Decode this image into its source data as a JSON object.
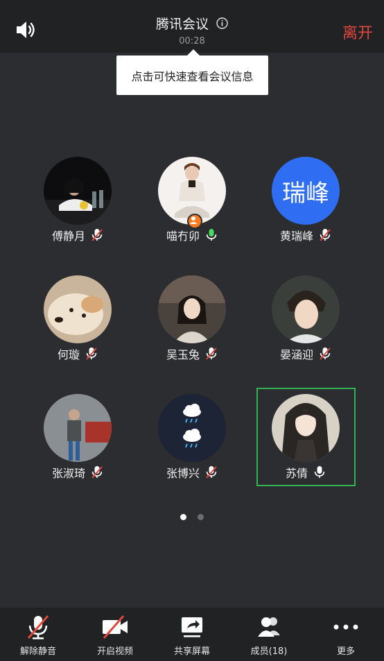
{
  "header": {
    "title": "腾讯会议",
    "timer": "00:28",
    "leave_label": "离开"
  },
  "tooltip": {
    "text": "点击可快速查看会议信息"
  },
  "participants": [
    {
      "name": "傅静月",
      "mic": "muted"
    },
    {
      "name": "喵冇卯",
      "mic": "on",
      "host": true
    },
    {
      "name": "黄瑞峰",
      "mic": "muted",
      "avatar_text": "瑞峰"
    },
    {
      "name": "何璇",
      "mic": "muted"
    },
    {
      "name": "吴玉兔",
      "mic": "muted"
    },
    {
      "name": "晏涵迎",
      "mic": "muted"
    },
    {
      "name": "张淑琦",
      "mic": "muted"
    },
    {
      "name": "张博兴",
      "mic": "muted"
    },
    {
      "name": "苏倩",
      "mic": "on",
      "active_speaker": true
    }
  ],
  "pagination": {
    "current": 1,
    "total": 2
  },
  "toolbar": {
    "unmute": "解除静音",
    "start_video": "开启视频",
    "share_screen": "共享屏幕",
    "members": "成员(18)",
    "more": "更多"
  },
  "colors": {
    "leave": "#e0473e",
    "active_frame": "#33b555",
    "mic_on": "#4cd964",
    "avatar_blue": "#2f6ef2"
  }
}
